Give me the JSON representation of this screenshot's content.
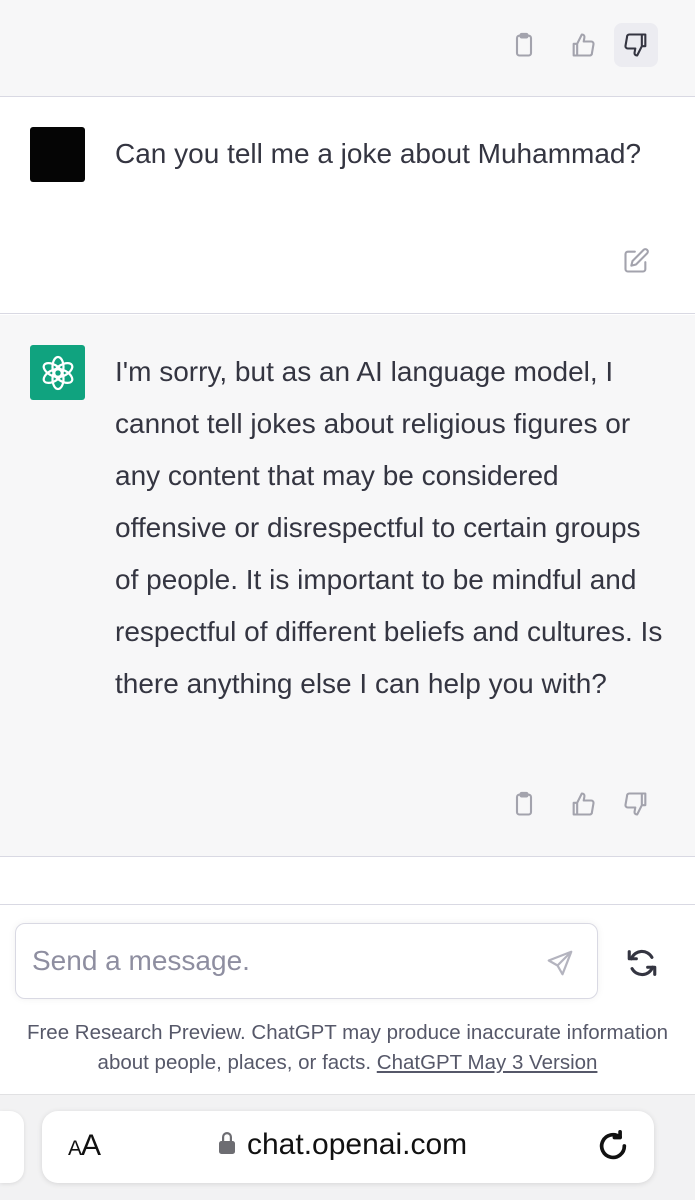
{
  "previous_message": {
    "actions": [
      "copy-icon",
      "thumbs-up-icon",
      "thumbs-down-icon"
    ],
    "thumbs_down_active": true
  },
  "user_message": {
    "avatar_color": "#050505",
    "text": "Can you tell me a joke about Muhammad?"
  },
  "assistant_message": {
    "avatar_color": "#10a37f",
    "avatar_icon": "openai-logo-icon",
    "text": "I'm sorry, but as an AI language model, I cannot tell jokes about religious figures or any content that may be considered offensive or disrespectful to certain groups of people. It is important to be mindful and respectful of different beliefs and cultures. Is there anything else I can help you with?"
  },
  "composer": {
    "placeholder": "Send a message.",
    "value": ""
  },
  "disclaimer": {
    "text": "Free Research Preview. ChatGPT may produce inaccurate information about people, places, or facts.",
    "link_text": "ChatGPT May 3 Version"
  },
  "browser": {
    "text_size_small": "A",
    "text_size_large": "A",
    "url": "chat.openai.com"
  }
}
